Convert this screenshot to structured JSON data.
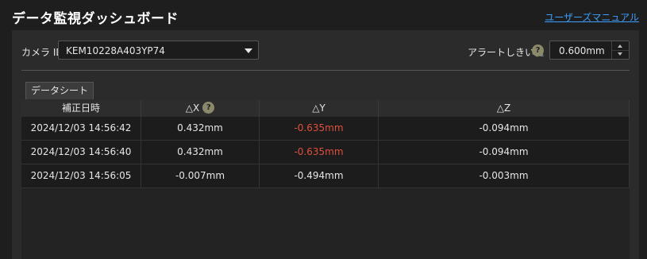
{
  "header": {
    "title": "データ監視ダッシュボード",
    "manual_link": "ユーザーズマニュアル"
  },
  "camera": {
    "label": "カメラ ID",
    "selected": "KEM10228A403YP74"
  },
  "alert": {
    "label": "アラートしきい値",
    "help": "?",
    "value": "0.600mm"
  },
  "tab": {
    "label": "データシート"
  },
  "table": {
    "columns": [
      "補正日時",
      "△X",
      "△Y",
      "△Z"
    ],
    "x_help": "?",
    "rows": [
      {
        "time": "2024/12/03 14:56:42",
        "dx": "0.432mm",
        "dy": "-0.635mm",
        "dz": "-0.094mm",
        "dy_alert": true
      },
      {
        "time": "2024/12/03 14:56:40",
        "dx": "0.432mm",
        "dy": "-0.635mm",
        "dz": "-0.094mm",
        "dy_alert": true
      },
      {
        "time": "2024/12/03 14:56:05",
        "dx": "-0.007mm",
        "dy": "-0.494mm",
        "dz": "-0.003mm",
        "dy_alert": false
      }
    ]
  },
  "colors": {
    "link": "#3ba0ff",
    "alert_value": "#e0503c",
    "panel": "#2b2b2b"
  }
}
